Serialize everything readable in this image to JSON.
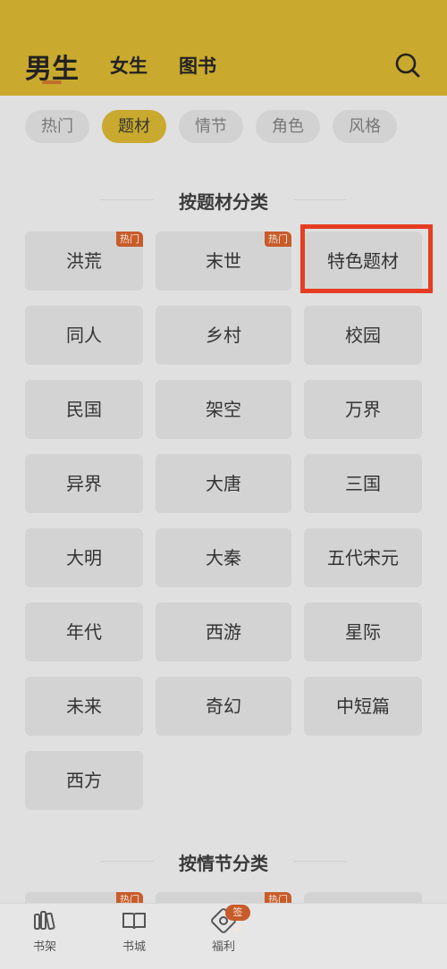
{
  "header": {
    "tabs": [
      "男生",
      "女生",
      "图书"
    ],
    "accent": "#c9a92e"
  },
  "filters": [
    "热门",
    "题材",
    "情节",
    "角色",
    "风格"
  ],
  "section_theme": {
    "title": "按题材分类",
    "rows": [
      [
        {
          "label": "洪荒",
          "badge": "热门"
        },
        {
          "label": "末世",
          "badge": "热门"
        },
        {
          "label": "特色题材"
        }
      ],
      [
        {
          "label": "同人"
        },
        {
          "label": "乡村"
        },
        {
          "label": "校园"
        }
      ],
      [
        {
          "label": "民国"
        },
        {
          "label": "架空"
        },
        {
          "label": "万界"
        }
      ],
      [
        {
          "label": "异界"
        },
        {
          "label": "大唐"
        },
        {
          "label": "三国"
        }
      ],
      [
        {
          "label": "大明"
        },
        {
          "label": "大秦"
        },
        {
          "label": "五代宋元"
        }
      ],
      [
        {
          "label": "年代"
        },
        {
          "label": "西游"
        },
        {
          "label": "星际"
        }
      ],
      [
        {
          "label": "未来"
        },
        {
          "label": "奇幻"
        },
        {
          "label": "中短篇"
        }
      ],
      [
        {
          "label": "西方"
        }
      ]
    ]
  },
  "section_plot": {
    "title": "按情节分类",
    "badges": [
      "热门",
      "热门"
    ]
  },
  "bottom_nav": [
    {
      "label": "书架",
      "icon": "bookshelf-icon"
    },
    {
      "label": "书城",
      "icon": "open-book-icon"
    },
    {
      "label": "福利",
      "icon": "gift-badge-icon",
      "badge": "签到"
    }
  ]
}
